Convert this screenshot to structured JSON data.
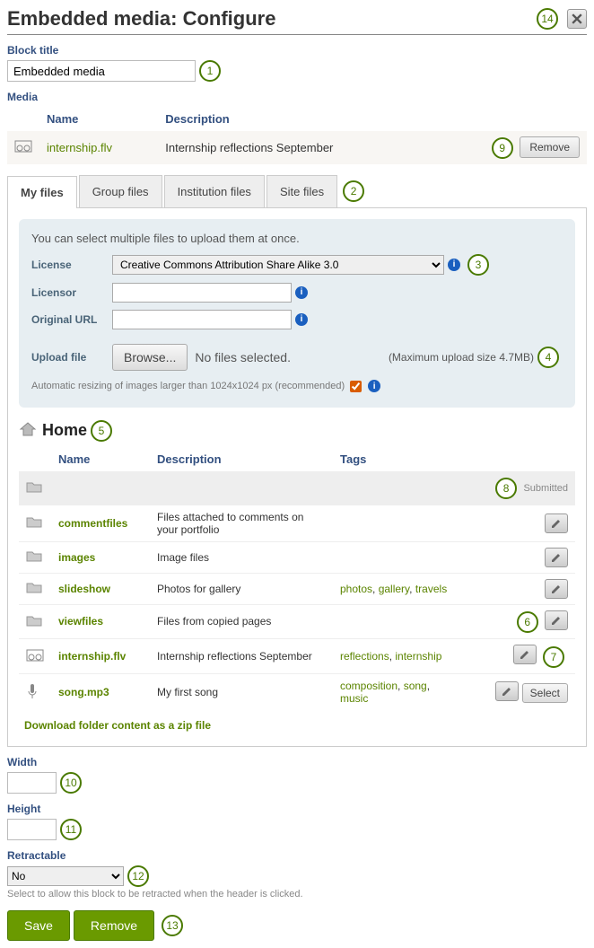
{
  "header": {
    "title_prefix": "Embedded media: ",
    "title_action": "Configure"
  },
  "block_title": {
    "label": "Block title",
    "value": "Embedded media"
  },
  "media_section_label": "Media",
  "media_headers": {
    "name": "Name",
    "description": "Description"
  },
  "attached_media": {
    "name": "internship.flv",
    "description": "Internship reflections September",
    "remove_label": "Remove"
  },
  "tabs": [
    {
      "label": "My files",
      "active": true
    },
    {
      "label": "Group files",
      "active": false
    },
    {
      "label": "Institution files",
      "active": false
    },
    {
      "label": "Site files",
      "active": false
    }
  ],
  "upload": {
    "intro": "You can select multiple files to upload them at once.",
    "license_label": "License",
    "license_value": "Creative Commons Attribution Share Alike 3.0",
    "licensor_label": "Licensor",
    "licensor_value": "",
    "original_url_label": "Original URL",
    "original_url_value": "",
    "upload_file_label": "Upload file",
    "browse_label": "Browse...",
    "no_files_selected": "No files selected.",
    "max_size": "(Maximum upload size 4.7MB)",
    "resize_note": "Automatic resizing of images larger than 1024x1024 px (recommended)"
  },
  "breadcrumb": {
    "home": "Home"
  },
  "file_columns": {
    "name": "Name",
    "description": "Description",
    "tags": "Tags"
  },
  "submitted_label": "Submitted",
  "files": [
    {
      "type": "folder",
      "name": "commentfiles",
      "description": "Files attached to comments on your portfolio",
      "tags": []
    },
    {
      "type": "folder",
      "name": "images",
      "description": "Image files",
      "tags": []
    },
    {
      "type": "folder",
      "name": "slideshow",
      "description": "Photos for gallery",
      "tags": [
        "photos",
        "gallery",
        "travels"
      ]
    },
    {
      "type": "folder",
      "name": "viewfiles",
      "description": "Files from copied pages",
      "tags": []
    },
    {
      "type": "video",
      "name": "internship.flv",
      "description": "Internship reflections September",
      "tags": [
        "reflections",
        "internship"
      ]
    },
    {
      "type": "audio",
      "name": "song.mp3",
      "description": "My first song",
      "tags": [
        "composition",
        "song",
        "music"
      ]
    }
  ],
  "select_label": "Select",
  "download_zip": "Download folder content as a zip file",
  "width": {
    "label": "Width",
    "value": ""
  },
  "height": {
    "label": "Height",
    "value": ""
  },
  "retractable": {
    "label": "Retractable",
    "value": "No",
    "help": "Select to allow this block to be retracted when the header is clicked."
  },
  "buttons": {
    "save": "Save",
    "remove": "Remove"
  },
  "markers": {
    "m1": "1",
    "m2": "2",
    "m3": "3",
    "m4": "4",
    "m5": "5",
    "m6": "6",
    "m7": "7",
    "m8": "8",
    "m9": "9",
    "m10": "10",
    "m11": "11",
    "m12": "12",
    "m13": "13",
    "m14": "14"
  }
}
